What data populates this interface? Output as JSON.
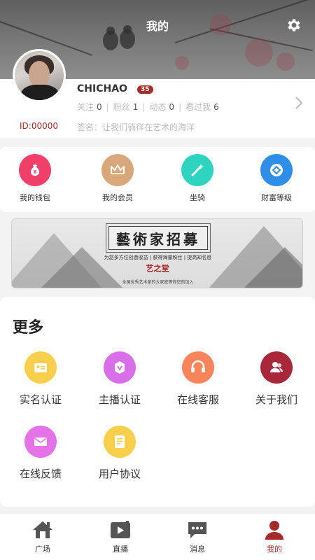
{
  "header": {
    "title": "我的",
    "settings_icon": "gear-icon"
  },
  "profile": {
    "username": "CHICHAO",
    "level": "35",
    "stats": [
      {
        "label": "关注",
        "value": "0"
      },
      {
        "label": "粉丝",
        "value": "1"
      },
      {
        "label": "动态",
        "value": "0"
      },
      {
        "label": "看过我",
        "value": "6"
      }
    ],
    "id": "ID:00000",
    "signature": "签名：让我们徜徉在艺术的海洋"
  },
  "quick_actions": [
    {
      "label": "我的钱包",
      "icon": "wallet-icon",
      "color": "#f0406a"
    },
    {
      "label": "我的会员",
      "icon": "crown-icon",
      "color": "#d8a87a"
    },
    {
      "label": "坐骑",
      "icon": "magic-wand-icon",
      "color": "#2fd4c0"
    },
    {
      "label": "财富等级",
      "icon": "diamond-icon",
      "color": "#2f8fe8"
    }
  ],
  "promo": {
    "title": "藝術家招募",
    "subtitle": "为您多方位创造收益 | 获得海量粉丝 | 提高知名度",
    "brand": "艺之堂",
    "footer": "全国优秀艺术家的大家庭等你您的加入"
  },
  "more": {
    "title": "更多",
    "items": [
      {
        "label": "实名认证",
        "icon": "id-card-icon",
        "color": "#f7cf4b"
      },
      {
        "label": "主播认证",
        "icon": "anchor-verify-icon",
        "color": "#d96fe8"
      },
      {
        "label": "在线客服",
        "icon": "headset-icon",
        "color": "#f7845a"
      },
      {
        "label": "关于我们",
        "icon": "people-icon",
        "color": "#a8283a"
      },
      {
        "label": "在线反馈",
        "icon": "mail-icon",
        "color": "#e373e6"
      },
      {
        "label": "用户协议",
        "icon": "document-icon",
        "color": "#f7cf4b"
      }
    ]
  },
  "tabbar": {
    "items": [
      {
        "label": "广场",
        "icon": "home-icon"
      },
      {
        "label": "直播",
        "icon": "live-video-icon"
      },
      {
        "label": "消息",
        "icon": "chat-icon"
      },
      {
        "label": "我的",
        "icon": "user-icon",
        "active": true
      }
    ],
    "active_color": "#a52a2a"
  }
}
